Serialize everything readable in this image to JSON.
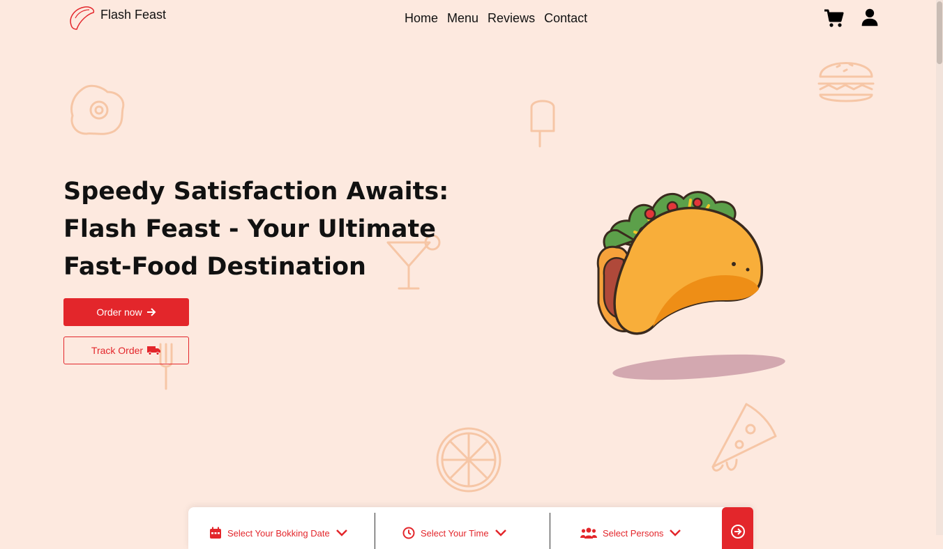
{
  "brand": {
    "name": "Flash Feast"
  },
  "nav": [
    {
      "label": "Home"
    },
    {
      "label": "Menu"
    },
    {
      "label": "Reviews"
    },
    {
      "label": "Contact"
    }
  ],
  "hero": {
    "title": "Speedy Satisfaction Awaits: Flash Feast - Your Ultimate Fast-Food Destination",
    "order_button": "Order now",
    "track_button": "Track Order"
  },
  "booking": {
    "date_placeholder": "Select Your Bokking Date",
    "time_placeholder": "Select Your Time",
    "persons_placeholder": "Select Persons"
  },
  "colors": {
    "accent": "#e3262b",
    "background": "#fde9df",
    "decoration": "#f6c6a6"
  },
  "icons": {
    "cart": "cart-icon",
    "user": "user-icon",
    "arrow": "arrow-right-icon",
    "truck": "truck-icon",
    "calendar": "calendar-icon",
    "clock": "clock-icon",
    "persons": "users-icon",
    "submit": "arrow-circle-right-icon"
  }
}
